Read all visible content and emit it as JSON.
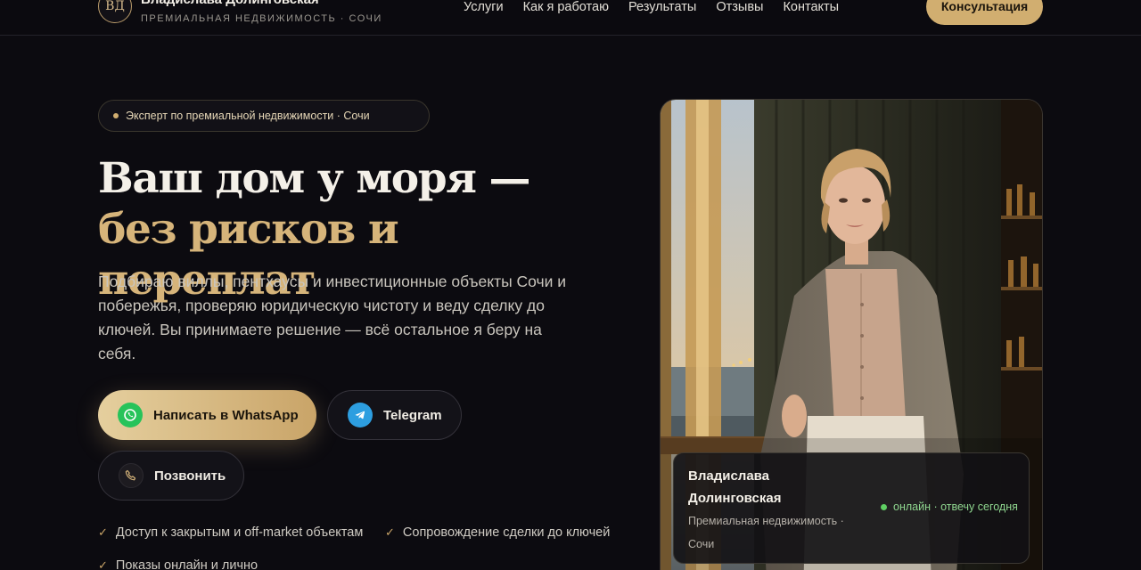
{
  "header": {
    "logo_mark": "ВД",
    "brand_name": "Владислава Долинговская",
    "brand_sub": "ПРЕМИАЛЬНАЯ НЕДВИЖИМОСТЬ · СОЧИ",
    "nav": [
      "Услуги",
      "Как я работаю",
      "Результаты",
      "Отзывы",
      "Контакты"
    ],
    "cta": "Консультация"
  },
  "hero": {
    "badge": "Эксперт по премиальной недвижимости · Сочи",
    "headline_white": "Ваш дом у моря — ",
    "headline_gold": "без рисков и переплат",
    "lead": "Подбираю виллы, пентхаусы и инвестиционные объекты Сочи и побережья, проверяю юридическую чистоту и веду сделку до ключей. Вы принимаете решение — всё остальное я беру на себя.",
    "buttons": {
      "whatsapp": "Написать в WhatsApp",
      "telegram": "Telegram",
      "call": "Позвонить"
    },
    "features": [
      "Доступ к закрытым и off-market объектам",
      "Сопровождение сделки до ключей",
      "Показы онлайн и лично"
    ]
  },
  "profile_card": {
    "name": "Владислава Долинговская",
    "subtitle": "Премиальная недвижимость · Сочи",
    "status": "онлайн · отвечу сегодня"
  },
  "colors": {
    "background": "#0c0b10",
    "accent_gold": "#d1ae70",
    "status_green": "#5fcf63"
  },
  "icons": [
    "whatsapp-icon",
    "telegram-icon",
    "phone-icon",
    "check-icon"
  ]
}
